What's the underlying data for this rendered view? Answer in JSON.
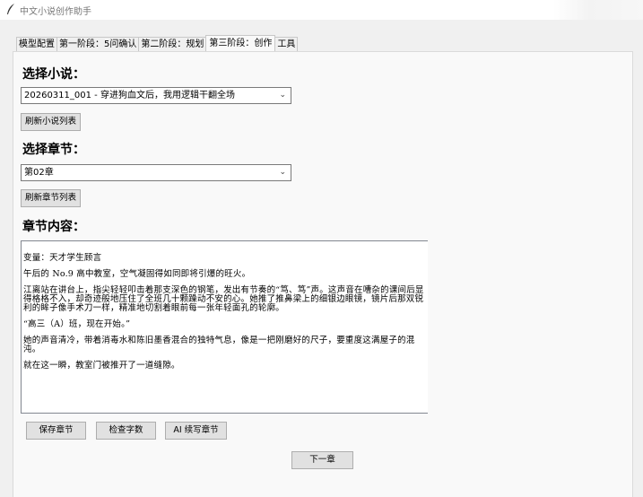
{
  "window": {
    "title": "中文小说创作助手",
    "icon": "feather-icon"
  },
  "tabs": [
    {
      "label": "模型配置",
      "active": false
    },
    {
      "label": "第一阶段：5问确认",
      "active": false
    },
    {
      "label": "第二阶段：规划",
      "active": false
    },
    {
      "label": "第三阶段：创作",
      "active": true
    },
    {
      "label": "工具",
      "active": false
    }
  ],
  "novel": {
    "heading": "选择小说：",
    "selected": "20260311_001 - 穿进狗血文后，我用逻辑干翻全场",
    "refresh_label": "刷新小说列表"
  },
  "chapter": {
    "heading": "选择章节：",
    "selected": "第02章",
    "refresh_label": "刷新章节列表"
  },
  "content": {
    "heading": "章节内容：",
    "paragraphs": [
      "变量：天才学生顾言",
      "午后的 No.9 高中教室，空气凝固得如同即将引爆的旺火。",
      "江离站在讲台上，指尖轻轻叩击着那支深色的钢笔，发出有节奏的“笃、笃”声。这声音在嘈杂的课间后显得格格不入，却奇迹般地压住了全班几十颗躁动不安的心。她推了推鼻梁上的细银边眼镜，镜片后那双锐利的眸子像手术刀一样，精准地切割着眼前每一张年轻面孔的轮廓。",
      "“高三（A）班，现在开始。”",
      "她的声音清冷，带着消毒水和陈旧墨香混合的独特气息，像是一把刚磨好的尺子，要重度这满屋子的混沌。",
      "就在这一瞬，教室门被推开了一道缝隙。"
    ]
  },
  "actions": {
    "save_label": "保存章节",
    "check_label": "检查字数",
    "ai_label": "AI 续写章节",
    "next_label": "下一章"
  }
}
